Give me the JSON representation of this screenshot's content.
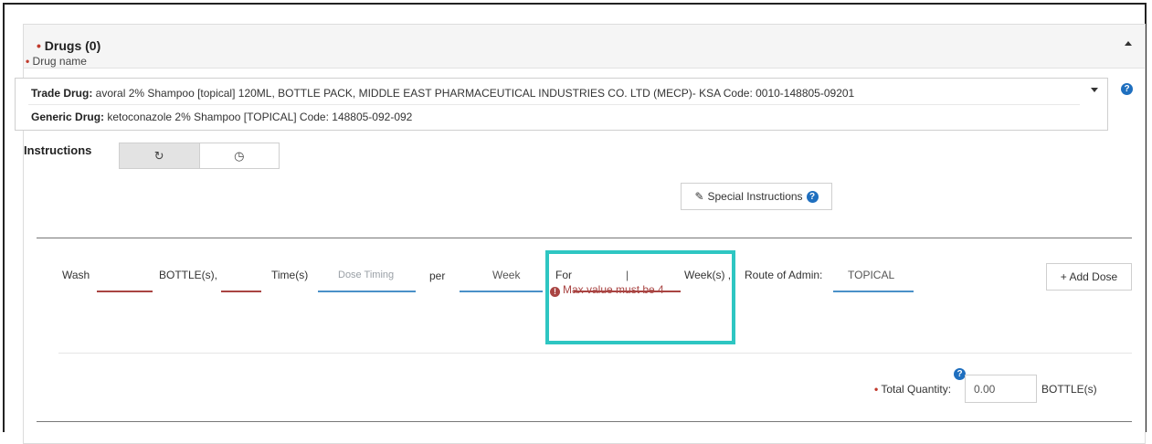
{
  "drugs_panel": {
    "title_prefix": "•",
    "title": "Drugs (0)"
  },
  "drug_name": {
    "required_mark": "•",
    "label": "Drug name",
    "help": "?",
    "trade_label": "Trade Drug:",
    "trade_value": " avoral 2% Shampoo [topical] 120ML, BOTTLE PACK, MIDDLE EAST PHARMACEUTICAL INDUSTRIES CO. LTD (MECP)- KSA Code: 0010-148805-09201",
    "generic_label": "Generic Drug:",
    "generic_value": " ketoconazole 2% Shampoo [TOPICAL] Code: 148805-092-092"
  },
  "instructions": {
    "label": "Instructions",
    "tab_repeat_icon": "↻",
    "tab_clock_icon": "◷"
  },
  "special_instructions": {
    "icon": "✎",
    "label": "Special Instructions",
    "help": "?"
  },
  "dose": {
    "wash": "Wash",
    "bottles": "BOTTLE(s),",
    "times": "Time(s)",
    "dose_timing_placeholder": "Dose Timing",
    "per": "per",
    "week_value": "Week",
    "for": "For",
    "for_value": "|",
    "weeks": "Week(s) ,",
    "route_label": "Route of Admin:",
    "route_value": "TOPICAL",
    "error_icon": "!",
    "error": "Max value must be 4",
    "add_dose": "+ Add Dose"
  },
  "total_quantity": {
    "required_mark": "•",
    "label": "Total Quantity:",
    "help": "?",
    "value": "0.00",
    "unit": "BOTTLE(s)"
  },
  "colors": {
    "highlight": "#2ec6c2",
    "error": "#a94442",
    "help_blue": "#1f6fbf",
    "required": "#c0392b"
  }
}
